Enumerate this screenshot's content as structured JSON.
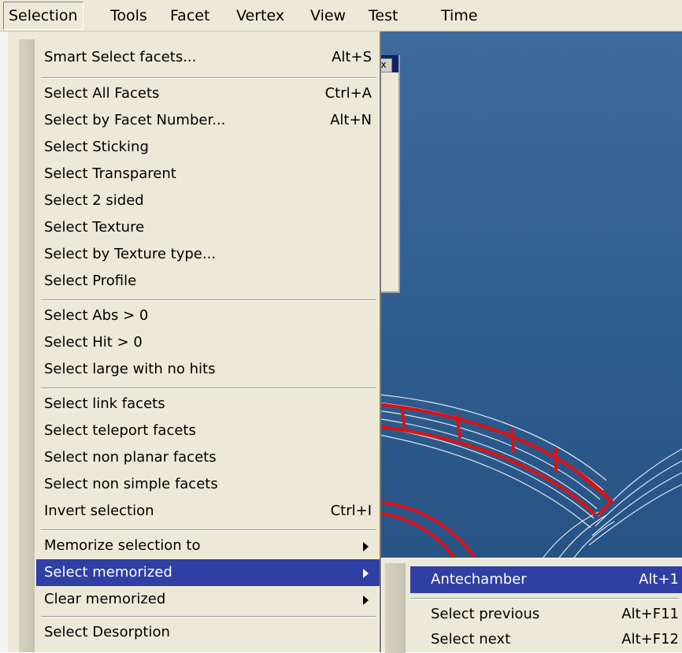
{
  "menubar": {
    "items": [
      "Selection",
      "Tools",
      "Facet",
      "Vertex",
      "View",
      "Test",
      "Time"
    ]
  },
  "background_window": {
    "close_glyph": "x"
  },
  "selection_menu": {
    "items": [
      {
        "label": "Smart Select facets...",
        "shortcut": "Alt+S"
      },
      {
        "label": "Select All Facets",
        "shortcut": "Ctrl+A"
      },
      {
        "label": "Select by Facet Number...",
        "shortcut": "Alt+N"
      },
      {
        "label": "Select Sticking",
        "shortcut": ""
      },
      {
        "label": "Select Transparent",
        "shortcut": ""
      },
      {
        "label": "Select 2 sided",
        "shortcut": ""
      },
      {
        "label": "Select Texture",
        "shortcut": ""
      },
      {
        "label": "Select by Texture type...",
        "shortcut": ""
      },
      {
        "label": "Select Profile",
        "shortcut": ""
      },
      {
        "label": "Select Abs > 0",
        "shortcut": ""
      },
      {
        "label": "Select Hit > 0",
        "shortcut": ""
      },
      {
        "label": "Select large with no hits",
        "shortcut": ""
      },
      {
        "label": "Select link facets",
        "shortcut": ""
      },
      {
        "label": "Select teleport facets",
        "shortcut": ""
      },
      {
        "label": "Select non planar facets",
        "shortcut": ""
      },
      {
        "label": "Select non simple facets",
        "shortcut": ""
      },
      {
        "label": "Invert selection",
        "shortcut": "Ctrl+I"
      },
      {
        "label": "Memorize selection to",
        "shortcut": ""
      },
      {
        "label": "Select memorized",
        "shortcut": ""
      },
      {
        "label": "Clear memorized",
        "shortcut": ""
      },
      {
        "label": "Select Desorption",
        "shortcut": ""
      }
    ]
  },
  "memorized_submenu": {
    "items": [
      {
        "label": "Antechamber",
        "shortcut": "Alt+1"
      },
      {
        "label": "Select previous",
        "shortcut": "Alt+F11"
      },
      {
        "label": "Select next",
        "shortcut": "Alt+F12"
      }
    ]
  },
  "colors": {
    "menu_bg": "#ece9d8",
    "highlight": "#2f3fa4",
    "viewport_bg": "#2f5e90",
    "geometry_red": "#e01010",
    "geometry_white": "#ffffff"
  }
}
